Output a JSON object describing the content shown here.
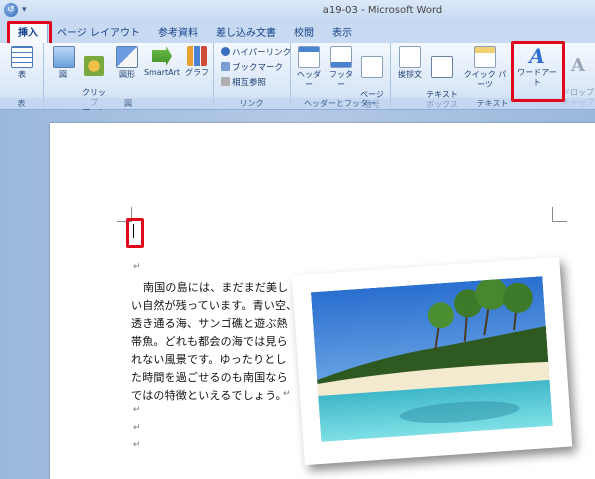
{
  "window": {
    "title": "a19-03 - Microsoft Word"
  },
  "tabs": [
    "挿入",
    "ページ レイアウト",
    "参考資料",
    "差し込み文書",
    "校閲",
    "表示"
  ],
  "ribbon": {
    "groups": {
      "table": "表",
      "illustrations": "図",
      "links": "リンク",
      "header_footer": "ヘッダーとフッター",
      "text": "テキスト"
    },
    "buttons": {
      "table": "表",
      "picture": "図",
      "clipart": "クリップ\nアート",
      "shapes": "図形",
      "smartart": "SmartArt",
      "chart": "グラフ",
      "hyperlink": "ハイパーリンク",
      "bookmark": "ブックマーク",
      "crossref": "相互参照",
      "header": "ヘッダー",
      "footer": "フッター",
      "pagenum": "ページ\n番号",
      "greeting": "挨拶文",
      "textbox": "テキスト\nボックス",
      "quickparts": "クイック パーツ",
      "wordart": "ワードアート",
      "dropcap": "ドロップ\nキャップ"
    }
  },
  "document": {
    "lines": [
      "南国の島には、まだまだ美し",
      "い自然が残っています。青い空、",
      "透き通る海、サンゴ礁と遊ぶ熱",
      "帯魚。どれも都会の海では見ら",
      "れない風景です。ゆったりとし",
      "た時間を過ごせるのも南国なら",
      "ではの特徴といえるでしょう。"
    ],
    "para_mark": "↵"
  }
}
